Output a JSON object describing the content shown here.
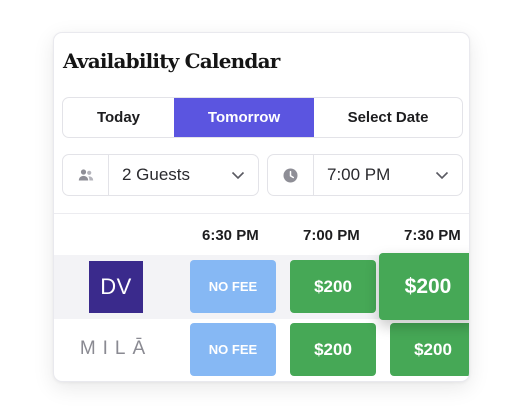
{
  "calendar": {
    "title": "Availability Calendar",
    "tabs": [
      {
        "label": "Today"
      },
      {
        "label": "Tomorrow",
        "active": true
      },
      {
        "label": "Select Date"
      }
    ],
    "guests": {
      "icon": "people-icon",
      "value": "2 Guests"
    },
    "time": {
      "icon": "clock-icon",
      "value": "7:00 PM"
    },
    "time_headers": [
      "6:30 PM",
      "7:00 PM",
      "7:30 PM"
    ],
    "restaurants": [
      {
        "logo_text": "DV",
        "slots": [
          "NO FEE",
          "$200",
          "$200"
        ]
      },
      {
        "logo_text": "MILĀ",
        "slots": [
          "NO FEE",
          "$200",
          "$200"
        ]
      }
    ]
  },
  "colors": {
    "active_tab": "#5b55e0",
    "no_fee": "#86b8f4",
    "paid": "#46a856",
    "dv_logo": "#3a2a8c"
  }
}
